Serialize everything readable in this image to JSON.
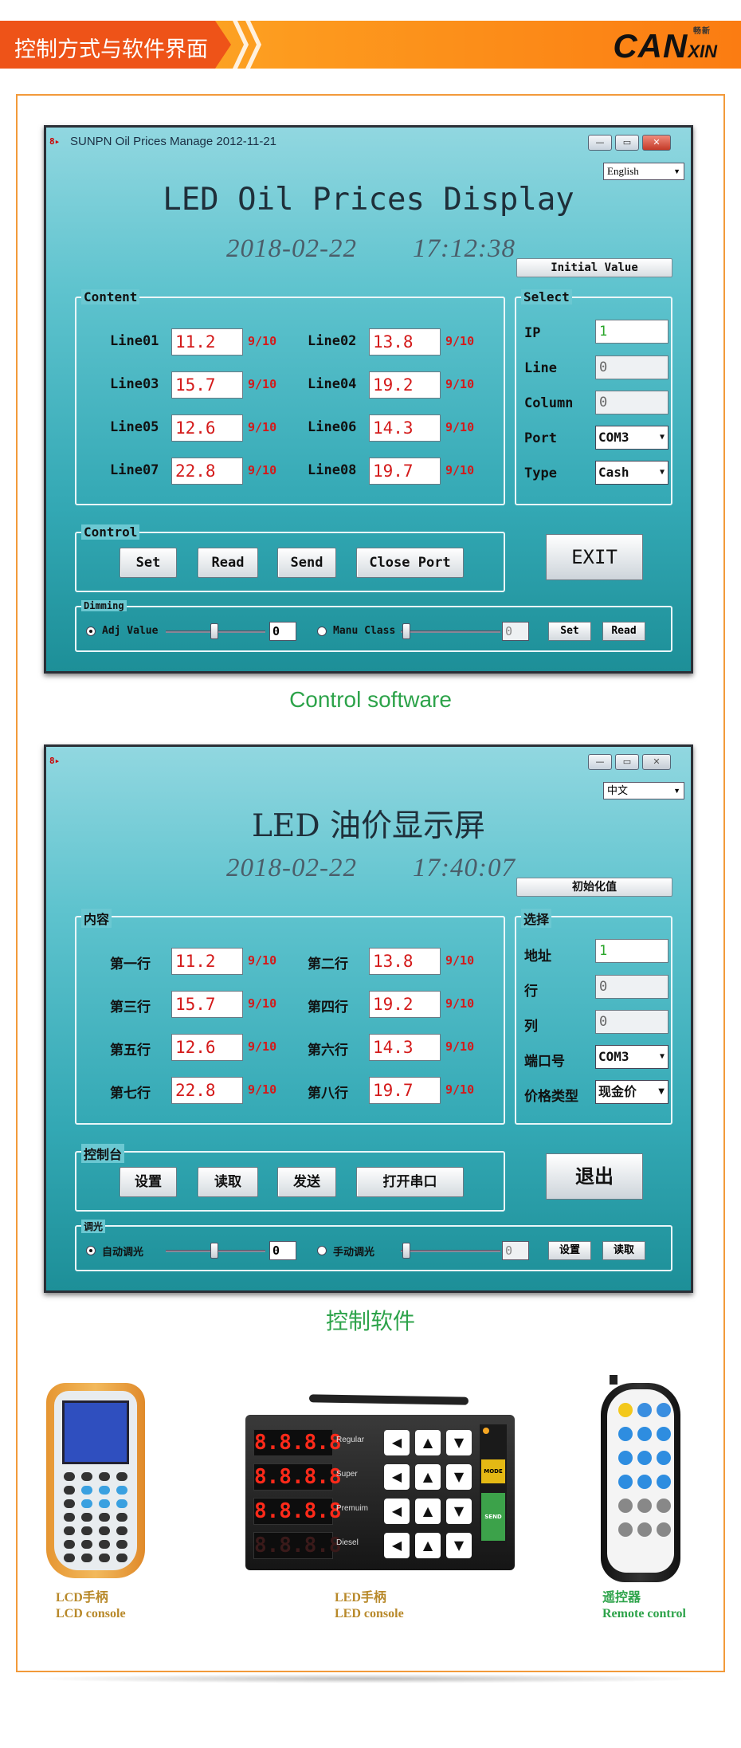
{
  "header": {
    "title": "控制方式与软件界面",
    "logo_main": "CAN",
    "logo_sub": "XIN",
    "logo_small": "畅新"
  },
  "win_en": {
    "title": "SUNPN Oil Prices Manage 2012-11-21",
    "btn_min": "—",
    "btn_max": "▭",
    "btn_close": "✕",
    "lang": "English",
    "heading": "LED Oil Prices Display",
    "date": "2018-02-22",
    "time": "17:12:38",
    "initial": "Initial Value",
    "content_label": "Content",
    "lines": [
      {
        "label": "Line01",
        "value": "11.2",
        "frac": "9/10"
      },
      {
        "label": "Line02",
        "value": "13.8",
        "frac": "9/10"
      },
      {
        "label": "Line03",
        "value": "15.7",
        "frac": "9/10"
      },
      {
        "label": "Line04",
        "value": "19.2",
        "frac": "9/10"
      },
      {
        "label": "Line05",
        "value": "12.6",
        "frac": "9/10"
      },
      {
        "label": "Line06",
        "value": "14.3",
        "frac": "9/10"
      },
      {
        "label": "Line07",
        "value": "22.8",
        "frac": "9/10"
      },
      {
        "label": "Line08",
        "value": "19.7",
        "frac": "9/10"
      }
    ],
    "select_label": "Select",
    "ip_label": "IP",
    "ip": "1",
    "line_label": "Line",
    "line_val": "0",
    "column_label": "Column",
    "column_val": "0",
    "port_label": "Port",
    "port": "COM3",
    "type_label": "Type",
    "type": "Cash",
    "control_label": "Control",
    "btn_set": "Set",
    "btn_read": "Read",
    "btn_send": "Send",
    "btn_close_port": "Close Port",
    "exit": "EXIT",
    "dimming_label": "Dimming",
    "adj_label": "Adj Value",
    "adj_val": "0",
    "manu_label": "Manu Class",
    "manu_val": "0",
    "dim_set": "Set",
    "dim_read": "Read"
  },
  "cap_en": "Control software",
  "win_cn": {
    "lang": "中文",
    "btn_min": "—",
    "btn_max": "▭",
    "btn_close": "✕",
    "heading": "LED 油价显示屏",
    "date": "2018-02-22",
    "time": "17:40:07",
    "initial": "初始化值",
    "content_label": "内容",
    "lines": [
      {
        "label": "第一行",
        "value": "11.2",
        "frac": "9/10"
      },
      {
        "label": "第二行",
        "value": "13.8",
        "frac": "9/10"
      },
      {
        "label": "第三行",
        "value": "15.7",
        "frac": "9/10"
      },
      {
        "label": "第四行",
        "value": "19.2",
        "frac": "9/10"
      },
      {
        "label": "第五行",
        "value": "12.6",
        "frac": "9/10"
      },
      {
        "label": "第六行",
        "value": "14.3",
        "frac": "9/10"
      },
      {
        "label": "第七行",
        "value": "22.8",
        "frac": "9/10"
      },
      {
        "label": "第八行",
        "value": "19.7",
        "frac": "9/10"
      }
    ],
    "select_label": "选择",
    "ip_label": "地址",
    "ip": "1",
    "line_label": "行",
    "line_val": "0",
    "column_label": "列",
    "column_val": "0",
    "port_label": "端口号",
    "port": "COM3",
    "type_label": "价格类型",
    "type": "现金价",
    "control_label": "控制台",
    "btn_set": "设置",
    "btn_read": "读取",
    "btn_send": "发送",
    "btn_close_port": "打开串口",
    "exit": "退出",
    "dimming_label": "调光",
    "adj_label": "自动调光",
    "adj_val": "0",
    "manu_label": "手动调光",
    "manu_val": "0",
    "dim_set": "设置",
    "dim_read": "读取"
  },
  "cap_cn": "控制软件",
  "devices": {
    "lcd": {
      "cn": "LCD手柄",
      "en": "LCD console"
    },
    "led": {
      "cn": "LED手柄",
      "en": "LED console",
      "rows": [
        "Regular",
        "Super",
        "Premuim",
        "Diesel"
      ],
      "digits": "8.8.8.8",
      "mode": "MODE",
      "send": "SEND"
    },
    "remote": {
      "cn": "遥控器",
      "en": "Remote control"
    }
  },
  "colors": {
    "accent": "#ee5318",
    "caption": "#2da34a",
    "value_red": "#d41a1a",
    "frame": "#f29a3a"
  }
}
